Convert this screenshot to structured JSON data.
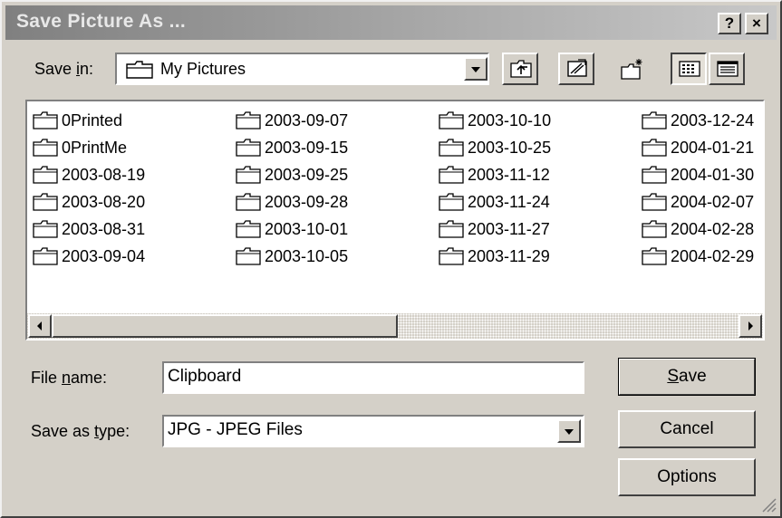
{
  "window": {
    "title": "Save Picture As ...",
    "help_label": "?",
    "close_label": "×"
  },
  "save_in": {
    "label_pre": "Save ",
    "label_key": "i",
    "label_post": "n:",
    "value": "My Pictures"
  },
  "toolbar": {
    "icons": [
      "up-one-level-icon",
      "desktop-icon",
      "new-folder-icon",
      "list-view-icon",
      "details-view-icon"
    ]
  },
  "files": {
    "columns": [
      [
        "0Printed",
        "0PrintMe",
        "2003-08-19",
        "2003-08-20",
        "2003-08-31",
        "2003-09-04"
      ],
      [
        "2003-09-07",
        "2003-09-15",
        "2003-09-25",
        "2003-09-28",
        "2003-10-01",
        "2003-10-05"
      ],
      [
        "2003-10-10",
        "2003-10-25",
        "2003-11-12",
        "2003-11-24",
        "2003-11-27",
        "2003-11-29"
      ],
      [
        "2003-12-24",
        "2004-01-21",
        "2004-01-30",
        "2004-02-07",
        "2004-02-28",
        "2004-02-29"
      ]
    ]
  },
  "form": {
    "file_name_pre": "File ",
    "file_name_key": "n",
    "file_name_post": "ame:",
    "file_name_value": "Clipboard",
    "save_type_pre": "Save as ",
    "save_type_key": "t",
    "save_type_post": "ype:",
    "save_type_value": "JPG - JPEG Files"
  },
  "buttons": {
    "save_key": "S",
    "save_rest": "ave",
    "cancel": "Cancel",
    "options": "Options"
  },
  "colors": {
    "title_start": "#808080",
    "title_end": "#c8c8c8",
    "face": "#d4d0c8"
  }
}
